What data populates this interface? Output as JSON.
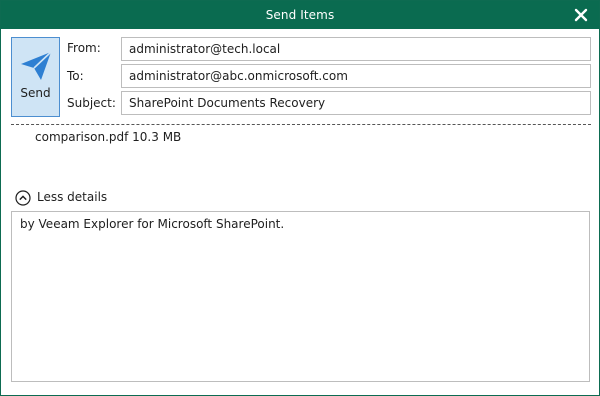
{
  "window": {
    "title": "Send Items",
    "close_icon": "close-icon",
    "accent_color": "#0a6b50"
  },
  "send_button": {
    "label": "Send",
    "icon": "paper-plane-icon"
  },
  "fields": {
    "from": {
      "label": "From:",
      "value": "administrator@tech.local"
    },
    "to": {
      "label": "To:",
      "value": "administrator@abc.onmicrosoft.com"
    },
    "subject": {
      "label": "Subject:",
      "value": "SharePoint Documents Recovery"
    }
  },
  "attachment": {
    "text": "comparison.pdf 10.3 MB"
  },
  "details_toggle": {
    "label": "Less details",
    "icon": "chevron-up-circle-icon"
  },
  "message": {
    "body": "by Veeam Explorer for Microsoft SharePoint."
  }
}
